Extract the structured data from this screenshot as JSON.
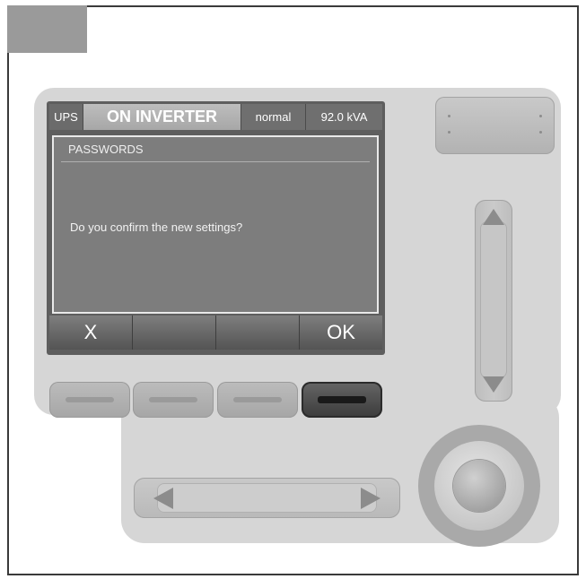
{
  "status_bar": {
    "source": "UPS",
    "mode": "ON INVERTER",
    "state": "normal",
    "power": "92.0 kVA"
  },
  "dialog": {
    "title": "PASSWORDS",
    "message": "Do you confirm the new settings?"
  },
  "softkeys": [
    {
      "label": "X"
    },
    {
      "label": ""
    },
    {
      "label": ""
    },
    {
      "label": "OK"
    }
  ],
  "icons": {
    "up_arrow": "triangle-up-icon",
    "down_arrow": "triangle-down-icon",
    "left_arrow": "triangle-left-icon",
    "right_arrow": "triangle-right-icon"
  },
  "colors": {
    "panel": "#d6d6d6",
    "screen_bg": "#7d7d7d",
    "active_button": "#3b3b3b"
  }
}
